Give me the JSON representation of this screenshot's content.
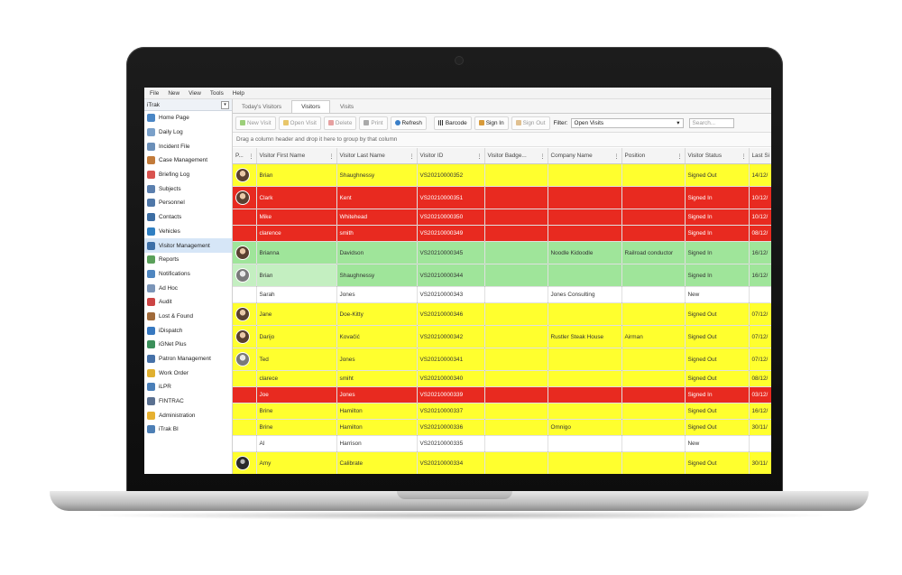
{
  "menu": [
    "File",
    "New",
    "View",
    "Tools",
    "Help"
  ],
  "sidebar": {
    "title": "iTrak",
    "items": [
      {
        "label": "Home Page",
        "icon": "home-icon",
        "color": "#4a86c5"
      },
      {
        "label": "Daily Log",
        "icon": "log-icon",
        "color": "#7aa0c9"
      },
      {
        "label": "Incident File",
        "icon": "file-icon",
        "color": "#6b8fb8"
      },
      {
        "label": "Case Management",
        "icon": "case-icon",
        "color": "#c27b3a"
      },
      {
        "label": "Briefing Log",
        "icon": "briefing-icon",
        "color": "#d9534f"
      },
      {
        "label": "Subjects",
        "icon": "subjects-icon",
        "color": "#5b7fae"
      },
      {
        "label": "Personnel",
        "icon": "personnel-icon",
        "color": "#4f77a8"
      },
      {
        "label": "Contacts",
        "icon": "contacts-icon",
        "color": "#3d6ea3"
      },
      {
        "label": "Vehicles",
        "icon": "vehicle-icon",
        "color": "#2f7fc2"
      },
      {
        "label": "Visitor Management",
        "icon": "visitor-icon",
        "color": "#3c6fa7"
      },
      {
        "label": "Reports",
        "icon": "reports-icon",
        "color": "#5aa05a"
      },
      {
        "label": "Notifications",
        "icon": "notifications-icon",
        "color": "#4f86c0"
      },
      {
        "label": "Ad Hoc",
        "icon": "adhoc-icon",
        "color": "#7b95b8"
      },
      {
        "label": "Audit",
        "icon": "audit-icon",
        "color": "#c44"
      },
      {
        "label": "Lost & Found",
        "icon": "lost-found-icon",
        "color": "#a06a3a"
      },
      {
        "label": "iDispatch",
        "icon": "dispatch-icon",
        "color": "#3778c0"
      },
      {
        "label": "iGNet Plus",
        "icon": "ignet-icon",
        "color": "#3b8f5a"
      },
      {
        "label": "Patron Management",
        "icon": "patron-icon",
        "color": "#4671a8"
      },
      {
        "label": "Work Order",
        "icon": "work-order-icon",
        "color": "#e0b030"
      },
      {
        "label": "iLPR",
        "icon": "lpr-icon",
        "color": "#4a7fb8"
      },
      {
        "label": "FINTRAC",
        "icon": "fintrac-icon",
        "color": "#5a7090"
      },
      {
        "label": "Administration",
        "icon": "admin-icon",
        "color": "#e6b030"
      },
      {
        "label": "iTrak BI",
        "icon": "bi-icon",
        "color": "#4d7fb5"
      }
    ],
    "active_index": 9
  },
  "tabs": [
    "Today's Visitors",
    "Visitors",
    "Visits"
  ],
  "active_tab": 1,
  "toolbar": {
    "new_visit": "New Visit",
    "open_visit": "Open Visit",
    "delete": "Delete",
    "print": "Print",
    "refresh": "Refresh",
    "barcode": "Barcode",
    "sign_in": "Sign In",
    "sign_out": "Sign Out",
    "filter_label": "Filter:",
    "filter_value": "Open Visits",
    "search_placeholder": "Search..."
  },
  "grouping_hint": "Drag a column header and drop it here to group by that column",
  "grid": {
    "columns": [
      "P...",
      "Visitor First Name",
      "Visitor Last Name",
      "Visitor ID",
      "Visitor Badge...",
      "Company Name",
      "Position",
      "Visitor Status",
      "Last Si"
    ],
    "rows": [
      {
        "photo": "avatar",
        "first": "Brian",
        "last": "Shaughnessy",
        "id": "VS20210000352",
        "badge": "",
        "company": "",
        "position": "",
        "status": "Signed Out",
        "last_si": "14/12/",
        "color": "yellow"
      },
      {
        "photo": "avatar",
        "first": "Clark",
        "last": "Kent",
        "id": "VS20210000351",
        "badge": "",
        "company": "",
        "position": "",
        "status": "Signed In",
        "last_si": "10/12/",
        "color": "red"
      },
      {
        "photo": "",
        "first": "Mike",
        "last": "Whitehead",
        "id": "VS20210000350",
        "badge": "",
        "company": "",
        "position": "",
        "status": "Signed In",
        "last_si": "10/12/",
        "color": "red"
      },
      {
        "photo": "",
        "first": "clarence",
        "last": "smith",
        "id": "VS20210000349",
        "badge": "",
        "company": "",
        "position": "",
        "status": "Signed In",
        "last_si": "08/12/",
        "color": "red"
      },
      {
        "photo": "avatar",
        "first": "Brianna",
        "last": "Davidson",
        "id": "VS20210000345",
        "badge": "",
        "company": "Noodle Kidoodle",
        "position": "Railroad conductor",
        "status": "Signed In",
        "last_si": "16/12/",
        "color": "green"
      },
      {
        "photo": "avatar-gray",
        "first": "Brian",
        "last": "Shaughnessy",
        "id": "VS20210000344",
        "badge": "",
        "company": "",
        "position": "",
        "status": "Signed In",
        "last_si": "16/12/",
        "color": "green"
      },
      {
        "photo": "",
        "first": "Sarah",
        "last": "Jones",
        "id": "VS20210000343",
        "badge": "",
        "company": "Jones Consulting",
        "position": "",
        "status": "New",
        "last_si": "",
        "color": "white"
      },
      {
        "photo": "avatar",
        "first": "Jane",
        "last": "Doe-Kitty",
        "id": "VS20210000346",
        "badge": "",
        "company": "",
        "position": "",
        "status": "Signed Out",
        "last_si": "07/12/",
        "color": "yellow"
      },
      {
        "photo": "avatar",
        "first": "Darijo",
        "last": "Kovačić",
        "id": "VS20210000342",
        "badge": "",
        "company": "Rustler Steak House",
        "position": "Airman",
        "status": "Signed Out",
        "last_si": "07/12/",
        "color": "yellow"
      },
      {
        "photo": "avatar-gray",
        "first": "Ted",
        "last": "Jones",
        "id": "VS20210000341",
        "badge": "",
        "company": "",
        "position": "",
        "status": "Signed Out",
        "last_si": "07/12/",
        "color": "yellow"
      },
      {
        "photo": "",
        "first": "clarece",
        "last": "smiht",
        "id": "VS20210000340",
        "badge": "",
        "company": "",
        "position": "",
        "status": "Signed Out",
        "last_si": "08/12/",
        "color": "yellow"
      },
      {
        "photo": "",
        "first": "Joe",
        "last": "Jones",
        "id": "VS20210000339",
        "badge": "",
        "company": "",
        "position": "",
        "status": "Signed In",
        "last_si": "03/12/",
        "color": "red"
      },
      {
        "photo": "",
        "first": "Brine",
        "last": "Hamilton",
        "id": "VS20210000337",
        "badge": "",
        "company": "",
        "position": "",
        "status": "Signed Out",
        "last_si": "16/12/",
        "color": "yellow"
      },
      {
        "photo": "",
        "first": "Brine",
        "last": "Hamilton",
        "id": "VS20210000336",
        "badge": "",
        "company": "Omnigo",
        "position": "",
        "status": "Signed Out",
        "last_si": "30/11/",
        "color": "yellow"
      },
      {
        "photo": "",
        "first": "Al",
        "last": "Harrison",
        "id": "VS20210000335",
        "badge": "",
        "company": "",
        "position": "",
        "status": "New",
        "last_si": "",
        "color": "white"
      },
      {
        "photo": "avatar-dark",
        "first": "Amy",
        "last": "Calibrate",
        "id": "VS20210000334",
        "badge": "",
        "company": "",
        "position": "",
        "status": "Signed Out",
        "last_si": "30/11/",
        "color": "yellow"
      }
    ]
  },
  "colors": {
    "signed_out": "#ffff2e",
    "signed_in_red": "#e82a20",
    "signed_in_green": "#9fe59a",
    "new": "#ffffff"
  }
}
